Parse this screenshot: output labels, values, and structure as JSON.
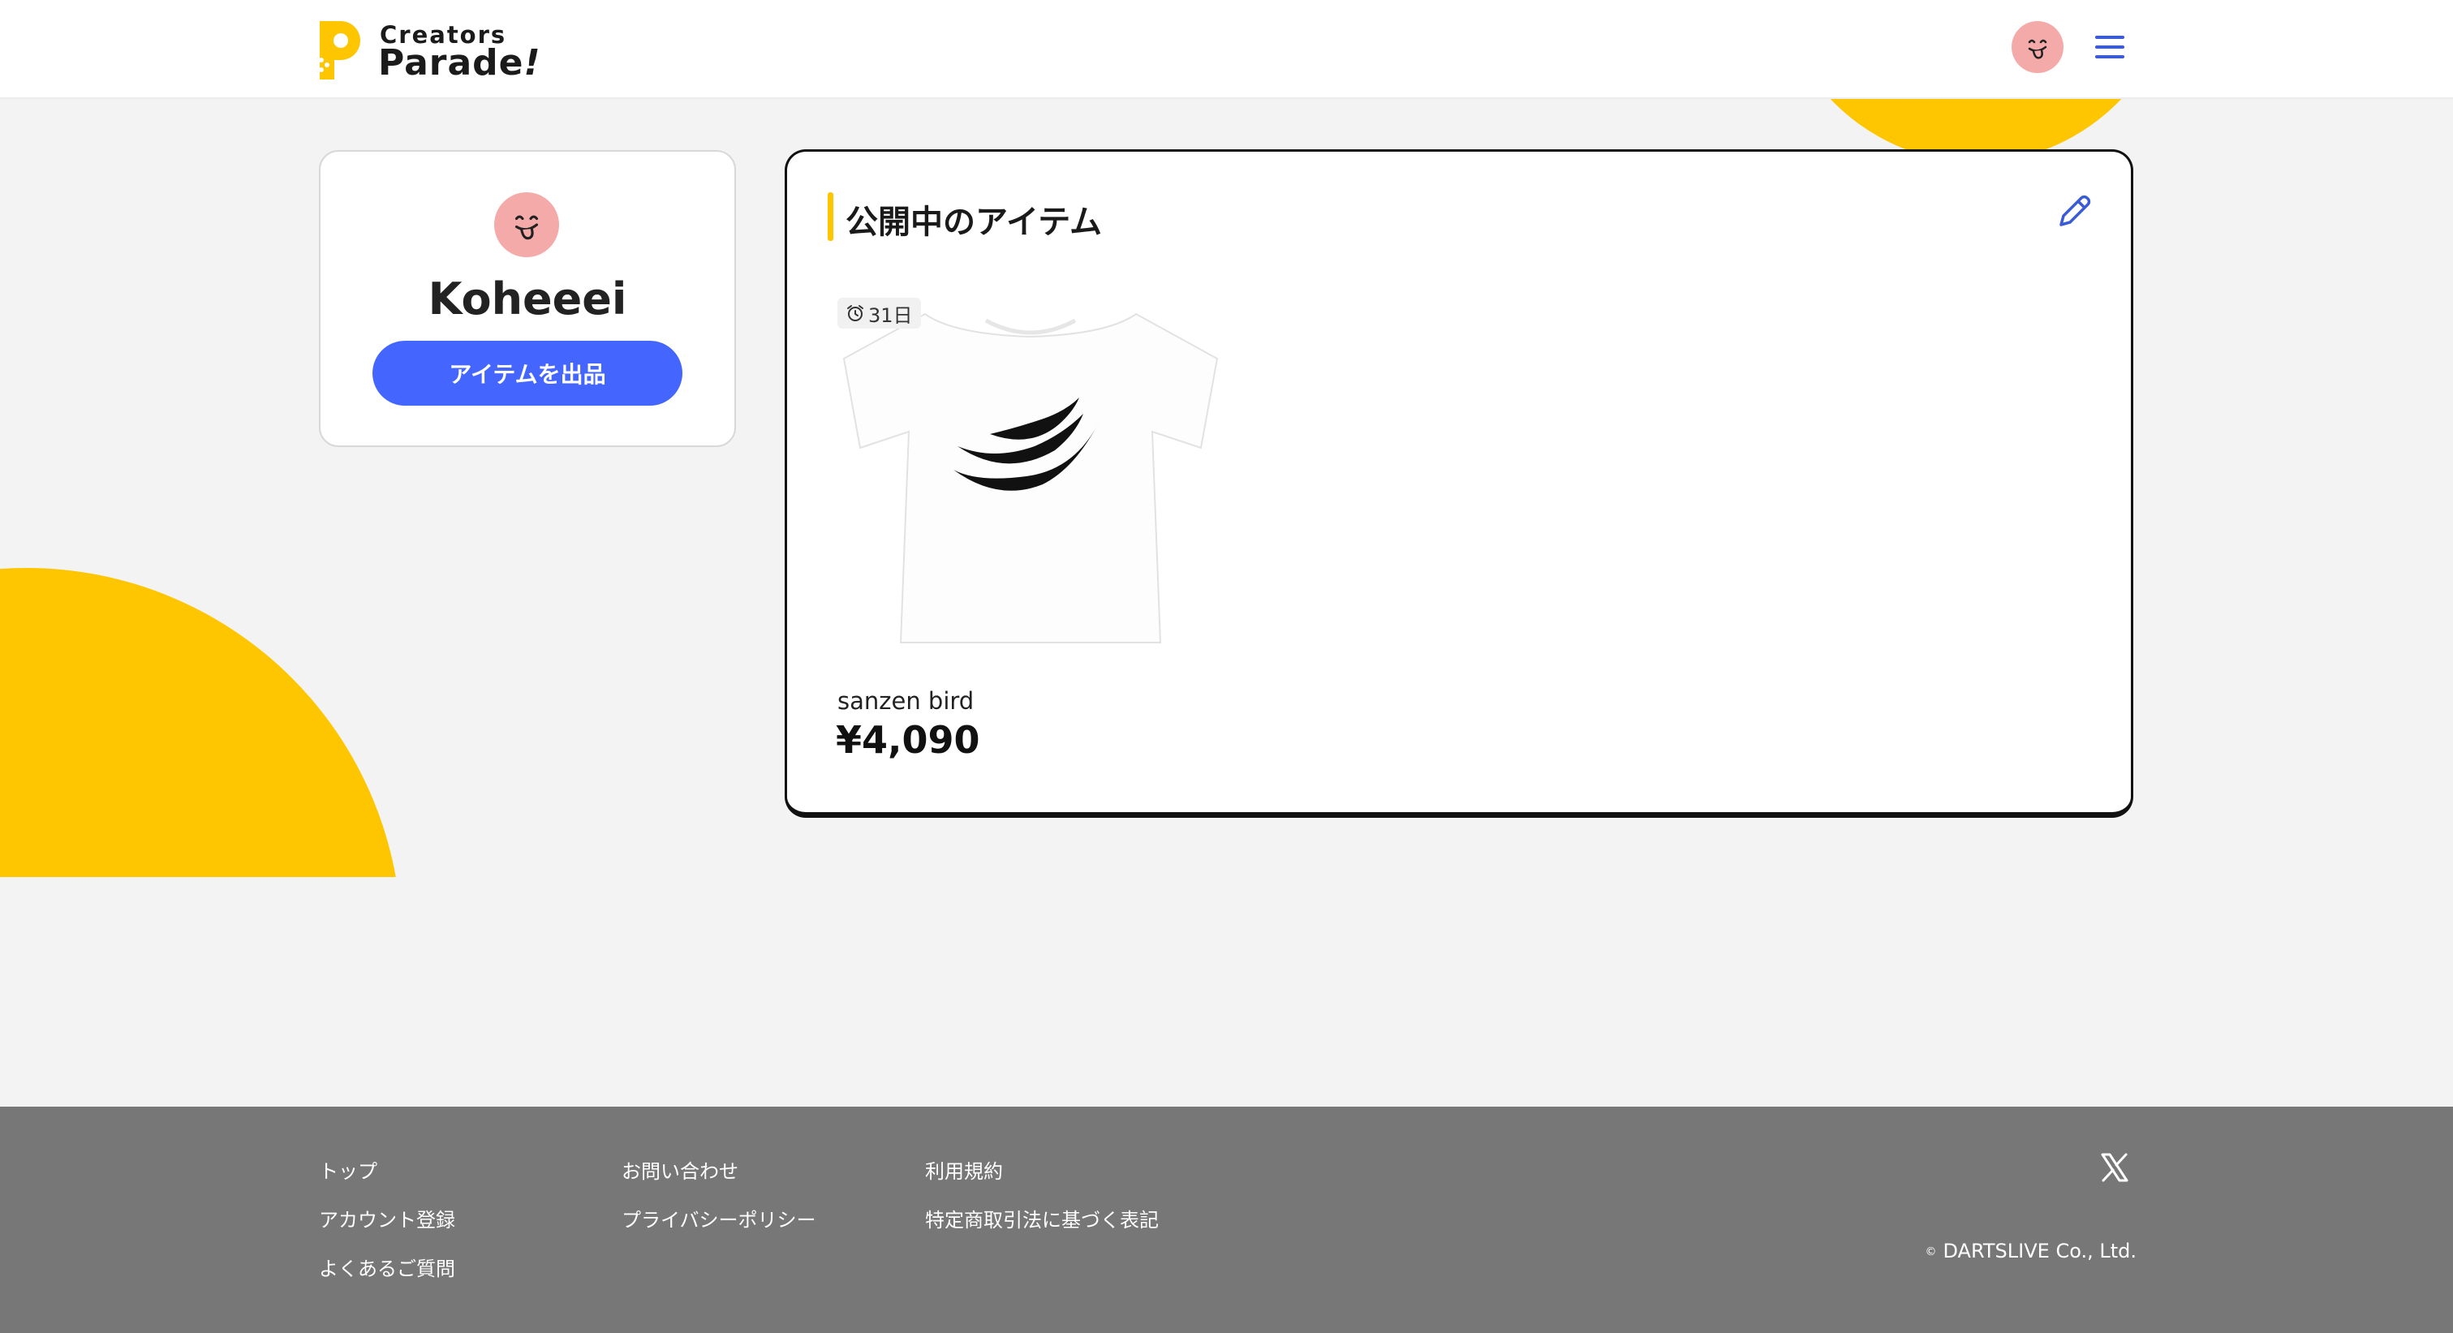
{
  "brand": {
    "logo_top": "Creators",
    "logo_bottom": "Parade",
    "logo_bang": "!",
    "yellow": "#fec600",
    "blue": "#4466ff"
  },
  "header": {
    "avatar_icon": "tongue-face-icon",
    "menu_icon": "hamburger-menu-icon"
  },
  "profile": {
    "name": "Koheeei",
    "list_button": "アイテムを出品"
  },
  "items_section": {
    "title": "公開中のアイテム",
    "edit_icon": "pencil-icon",
    "items": [
      {
        "deadline": "31日",
        "deadline_icon": "alarm-clock-icon",
        "name": "sanzen bird",
        "price": "¥4,090"
      }
    ]
  },
  "footer": {
    "col1": [
      "トップ",
      "アカウント登録",
      "よくあるご質問"
    ],
    "col2": [
      "お問い合わせ",
      "プライバシーポリシー"
    ],
    "col3": [
      "利用規約",
      "特定商取引法に基づく表記"
    ],
    "social_icon": "x-logo-icon",
    "copyright_mark": "©",
    "copyright": "DARTSLIVE Co., Ltd."
  }
}
